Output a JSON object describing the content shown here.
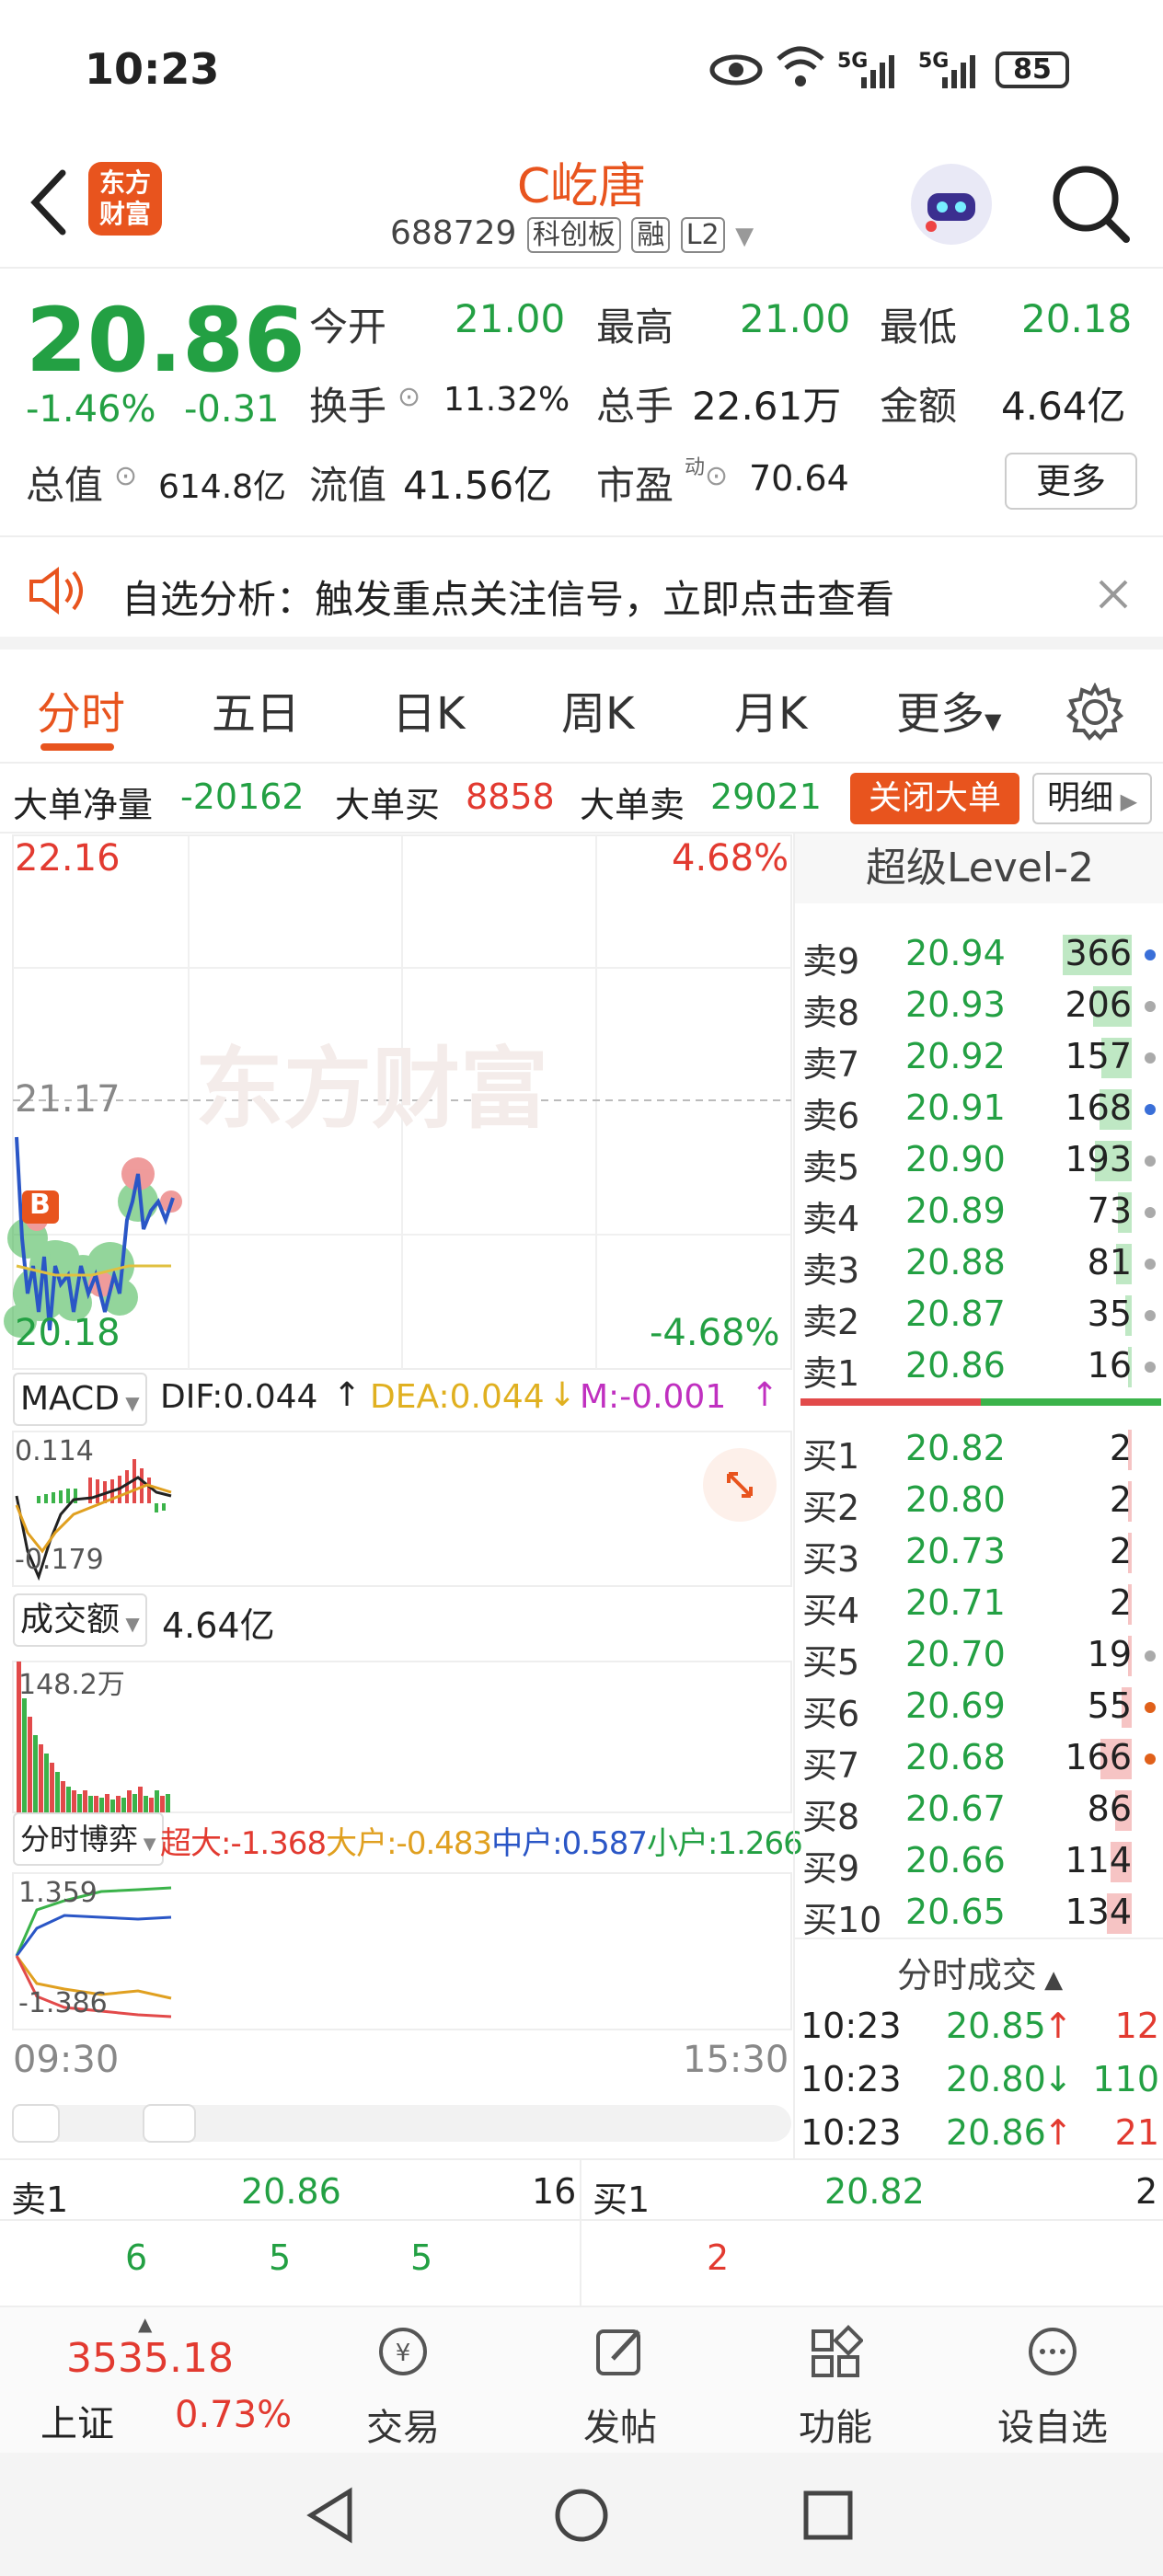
{
  "status_bar": {
    "time": "10:23",
    "battery": "85",
    "net1": "5G",
    "net2": "5G"
  },
  "header": {
    "logo_line1": "东方",
    "logo_line2": "财富",
    "title": "C屹唐",
    "code": "688729",
    "tag1": "科创板",
    "tag2": "融",
    "tag3": "L2"
  },
  "quote": {
    "price": "20.86",
    "change_pct": "-1.46%",
    "change": "-0.31",
    "open_label": "今开",
    "open": "21.00",
    "high_label": "最高",
    "high": "21.00",
    "low_label": "最低",
    "low": "20.18",
    "turnover_label": "换手",
    "turnover": "11.32%",
    "volume_label": "总手",
    "volume": "22.61万",
    "amount_label": "金额",
    "amount": "4.64亿",
    "mktcap_label": "总值",
    "mktcap": "614.8亿",
    "float_label": "流值",
    "float": "41.56亿",
    "pe_label": "市盈",
    "pe_sup": "动",
    "pe": "70.64",
    "more_button": "更多"
  },
  "notice": {
    "text": "自选分析：触发重点关注信号，立即点击查看"
  },
  "tabs": [
    "分时",
    "五日",
    "日K",
    "周K",
    "月K",
    "更多"
  ],
  "big_order": {
    "net_label": "大单净量",
    "net": "-20162",
    "buy_label": "大单买",
    "buy": "8858",
    "sell_label": "大单卖",
    "sell": "29021",
    "close_button": "关闭大单",
    "detail_button": "明细"
  },
  "chart": {
    "price_top": "22.16",
    "pct_top": "4.68%",
    "price_mid": "21.17",
    "price_bottom": "20.18",
    "pct_bottom": "-4.68%",
    "watermark": "东方财富",
    "b_marker": "B",
    "macd_label": "MACD",
    "dif": "DIF:0.044",
    "dif_arrow": "↑",
    "dea": "DEA:0.044",
    "dea_arrow": "↓",
    "m": "M:-0.001",
    "m_arrow": "↑",
    "macd_top": "0.114",
    "macd_bottom": "-0.179",
    "vol_label": "成交额",
    "vol_total": "4.64亿",
    "vol_max": "148.2万",
    "game_label": "分时博弈",
    "super_label": "超大:",
    "super": "-1.368",
    "large_label": "大户:",
    "large": "-0.483",
    "mid_label": "中户:",
    "mid": "0.587",
    "small_label": "小户:",
    "small": "1.266",
    "game_top": "1.359",
    "game_bottom": "-1.386",
    "time_start": "09:30",
    "time_end": "15:30"
  },
  "level2": {
    "title": "超级Level-2",
    "sells": [
      {
        "label": "卖9",
        "price": "20.94",
        "vol": "366",
        "bar": 0.75,
        "dot": "#3a6fd8"
      },
      {
        "label": "卖8",
        "price": "20.93",
        "vol": "206",
        "bar": 0.42,
        "dot": "#aaaaaa"
      },
      {
        "label": "卖7",
        "price": "20.92",
        "vol": "157",
        "bar": 0.33,
        "dot": "#aaaaaa"
      },
      {
        "label": "卖6",
        "price": "20.91",
        "vol": "168",
        "bar": 0.35,
        "dot": "#3a6fd8"
      },
      {
        "label": "卖5",
        "price": "20.90",
        "vol": "193",
        "bar": 0.4,
        "dot": "#aaaaaa"
      },
      {
        "label": "卖4",
        "price": "20.89",
        "vol": "73",
        "bar": 0.15,
        "dot": "#aaaaaa"
      },
      {
        "label": "卖3",
        "price": "20.88",
        "vol": "81",
        "bar": 0.17,
        "dot": "#aaaaaa"
      },
      {
        "label": "卖2",
        "price": "20.87",
        "vol": "35",
        "bar": 0.07,
        "dot": "#aaaaaa"
      },
      {
        "label": "卖1",
        "price": "20.86",
        "vol": "16",
        "bar": 0.03,
        "dot": "#aaaaaa"
      }
    ],
    "buys": [
      {
        "label": "买1",
        "price": "20.82",
        "vol": "2",
        "bar": 0.01,
        "dot": ""
      },
      {
        "label": "买2",
        "price": "20.80",
        "vol": "2",
        "bar": 0.01,
        "dot": ""
      },
      {
        "label": "买3",
        "price": "20.73",
        "vol": "2",
        "bar": 0.01,
        "dot": ""
      },
      {
        "label": "买4",
        "price": "20.71",
        "vol": "2",
        "bar": 0.01,
        "dot": ""
      },
      {
        "label": "买5",
        "price": "20.70",
        "vol": "19",
        "bar": 0.04,
        "dot": "#aaaaaa"
      },
      {
        "label": "买6",
        "price": "20.69",
        "vol": "55",
        "bar": 0.11,
        "dot": "#e0601a"
      },
      {
        "label": "买7",
        "price": "20.68",
        "vol": "166",
        "bar": 0.34,
        "dot": "#e0601a"
      },
      {
        "label": "买8",
        "price": "20.67",
        "vol": "86",
        "bar": 0.18,
        "dot": ""
      },
      {
        "label": "买9",
        "price": "20.66",
        "vol": "114",
        "bar": 0.23,
        "dot": ""
      },
      {
        "label": "买10",
        "price": "20.65",
        "vol": "134",
        "bar": 0.27,
        "dot": ""
      }
    ],
    "trades_title": "分时成交",
    "trades": [
      {
        "time": "10:23",
        "price": "20.85",
        "dir": "↑",
        "vol": "12",
        "color": "red"
      },
      {
        "time": "10:23",
        "price": "20.80",
        "dir": "↓",
        "vol": "110",
        "color": "green"
      },
      {
        "time": "10:23",
        "price": "20.86",
        "dir": "↑",
        "vol": "21",
        "color": "red"
      }
    ]
  },
  "quick": {
    "sell_label": "卖1",
    "sell_price": "20.86",
    "sell_vol": "16",
    "sell_q1": "6",
    "sell_q2": "5",
    "sell_q3": "5",
    "buy_label": "买1",
    "buy_price": "20.82",
    "buy_vol": "2",
    "buy_q1": "2"
  },
  "bottom_nav": {
    "index_value": "3535.18",
    "index_name": "上证",
    "index_pct": "0.73%",
    "trade": "交易",
    "post": "发帖",
    "func": "功能",
    "watch": "设自选"
  },
  "colors": {
    "accent": "#e8541e",
    "up": "#e23a30",
    "down": "#23a043"
  }
}
